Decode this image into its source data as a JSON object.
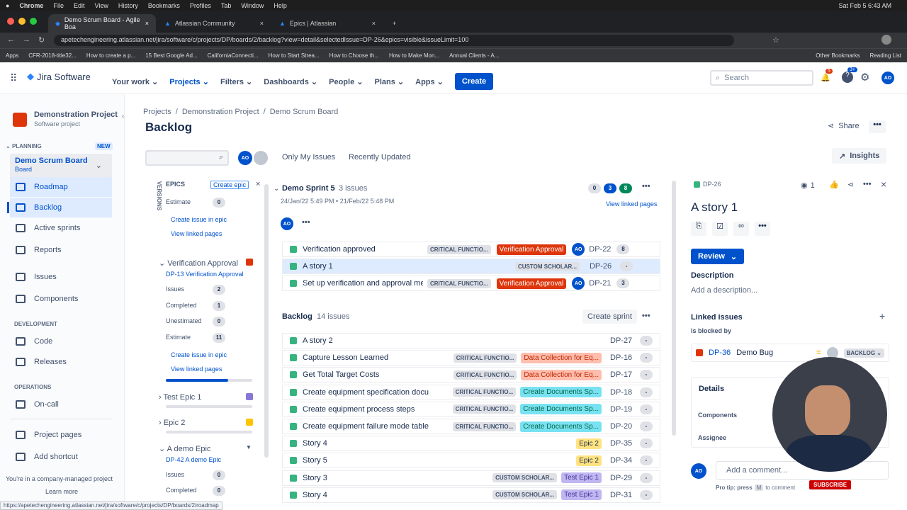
{
  "mac": {
    "apple": "",
    "app": "Chrome",
    "menus": [
      "File",
      "Edit",
      "View",
      "History",
      "Bookmarks",
      "Profiles",
      "Tab",
      "Window",
      "Help"
    ],
    "clock": "Sat Feb 5  6:43 AM"
  },
  "tabs": [
    {
      "label": "Demo Scrum Board - Agile Boa"
    },
    {
      "label": "Atlassian Community"
    },
    {
      "label": "Epics | Atlassian"
    }
  ],
  "url": "apetechengineering.atlassian.net/jira/software/c/projects/DP/boards/2/backlog?view=detail&selectedIssue=DP-26&epics=visible&issueLimit=100",
  "bookmarks": [
    "Apps",
    "CFR-2018-title32...",
    "How to create a p...",
    "15 Best Google Ad...",
    "CaliforniaConnecti...",
    "How to Start Strea...",
    "How to Choose th...",
    "How to Make Mon...",
    "Annual Clients - A..."
  ],
  "bookmarks_right": [
    "Other Bookmarks",
    "Reading List"
  ],
  "nav": {
    "logo": "Jira Software",
    "items": [
      "Your work",
      "Projects",
      "Filters",
      "Dashboards",
      "People",
      "Plans",
      "Apps"
    ],
    "create": "Create",
    "search": "Search",
    "notif_count": "5",
    "help_count": "3+",
    "avatar": "AO"
  },
  "project": {
    "name": "Demonstration Project",
    "type": "Software project"
  },
  "sidebar": {
    "planning": "PLANNING",
    "new": "NEW",
    "board": "Demo Scrum Board",
    "board_sub": "Board",
    "items": [
      "Roadmap",
      "Backlog",
      "Active sprints",
      "Reports",
      "Issues",
      "Components"
    ],
    "development": "DEVELOPMENT",
    "dev_items": [
      "Code",
      "Releases"
    ],
    "operations": "OPERATIONS",
    "ops_items": [
      "On-call"
    ],
    "bottom": [
      "Project pages",
      "Add shortcut"
    ],
    "footer": "You're in a company-managed project",
    "learn": "Learn more"
  },
  "breadcrumb": [
    "Projects",
    "Demonstration Project",
    "Demo Scrum Board"
  ],
  "page_title": "Backlog",
  "share": "Share",
  "insights": "Insights",
  "filters": {
    "only_my": "Only My Issues",
    "recent": "Recently Updated",
    "avatar": "AO"
  },
  "versions": "VERSIONS",
  "epics": {
    "title": "EPICS",
    "create": "Create epic",
    "estimate_label": "Estimate",
    "estimate_val": "0",
    "create_issue": "Create issue in epic",
    "view_linked": "View linked pages",
    "verif": {
      "name": "Verification Approval",
      "key": "DP-13 Verification Approval",
      "issues": "2",
      "completed": "1",
      "unestimated": "0",
      "estimate": "11"
    },
    "labels": {
      "issues": "Issues",
      "completed": "Completed",
      "unestimated": "Unestimated",
      "estimate": "Estimate"
    },
    "others": [
      "Test Epic 1",
      "Epic 2"
    ],
    "demo": {
      "name": "A demo Epic",
      "key": "DP-42 A demo Epic",
      "issues": "0",
      "completed": "0"
    }
  },
  "sprint": {
    "name": "Demo Sprint 5",
    "count": "3 issues",
    "dates": "24/Jan/22 5:49 PM  •  21/Feb/22 5:48 PM",
    "todo": "0",
    "inprog": "3",
    "done": "8",
    "view_linked": "View linked pages",
    "avatar": "AO",
    "rows": [
      {
        "title": "Verification approved",
        "comp": "CRITICAL FUNCTIO...",
        "epic": "Verification Approval",
        "epic_cls": "red",
        "avatar": "AO",
        "key": "DP-22",
        "est": "8"
      },
      {
        "title": "A story 1",
        "comp": "CUSTOM SCHOLAR...",
        "epic": "",
        "epic_cls": "",
        "avatar": "",
        "key": "DP-26",
        "est": "-"
      },
      {
        "title": "Set up verification and approval me",
        "comp": "CRITICAL FUNCTIO...",
        "epic": "Verification Approval",
        "epic_cls": "red",
        "avatar": "AO",
        "key": "DP-21",
        "est": "3"
      }
    ]
  },
  "backlog": {
    "name": "Backlog",
    "count": "14 issues",
    "create_sprint": "Create sprint",
    "rows": [
      {
        "title": "A story 2",
        "comp": "",
        "epic": "",
        "epic_cls": "",
        "key": "DP-27",
        "est": "-"
      },
      {
        "title": "Capture Lesson Learned",
        "comp": "CRITICAL FUNCTIO...",
        "epic": "Data Collection for Eq...",
        "epic_cls": "pinkl",
        "key": "DP-16",
        "est": "-"
      },
      {
        "title": "Get Total Target Costs",
        "comp": "CRITICAL FUNCTIO...",
        "epic": "Data Collection for Eq...",
        "epic_cls": "pinkl",
        "key": "DP-17",
        "est": "-"
      },
      {
        "title": "Create equipment specification docu",
        "comp": "CRITICAL FUNCTIO...",
        "epic": "Create Documents Sp...",
        "epic_cls": "teal",
        "key": "DP-18",
        "est": "-"
      },
      {
        "title": "Create equipment process steps",
        "comp": "CRITICAL FUNCTIO...",
        "epic": "Create Documents Sp...",
        "epic_cls": "teal",
        "key": "DP-19",
        "est": "-"
      },
      {
        "title": "Create equipment failure mode table",
        "comp": "CRITICAL FUNCTIO...",
        "epic": "Create Documents Sp...",
        "epic_cls": "teal",
        "key": "DP-20",
        "est": "-"
      },
      {
        "title": "Story 4",
        "comp": "",
        "epic": "Epic 2",
        "epic_cls": "yel",
        "key": "DP-35",
        "est": "-"
      },
      {
        "title": "Story 5",
        "comp": "",
        "epic": "Epic 2",
        "epic_cls": "yel",
        "key": "DP-34",
        "est": "-"
      },
      {
        "title": "Story 3",
        "comp": "CUSTOM SCHOLAR...",
        "epic": "Test Epic 1",
        "epic_cls": "purp",
        "key": "DP-29",
        "est": "-"
      },
      {
        "title": "Story 4",
        "comp": "CUSTOM SCHOLAR...",
        "epic": "Test Epic 1",
        "epic_cls": "purp",
        "key": "DP-31",
        "est": "-"
      }
    ]
  },
  "detail": {
    "key": "DP-26",
    "watch": "1",
    "title": "A story 1",
    "status": "Review",
    "desc_label": "Description",
    "desc_ph": "Add a description...",
    "linked": "Linked issues",
    "blocked_by": "is blocked by",
    "link_key": "DP-36",
    "link_title": "Demo Bug",
    "link_status": "BACKLOG",
    "details": "Details",
    "components": "Components",
    "assignee": "Assignee",
    "comment_ph": "Add a comment...",
    "protip": "Pro tip: press",
    "protip_key": "M",
    "protip_end": "to comment",
    "avatar": "AO",
    "subscribe": "SUBSCRIBE"
  },
  "status_url": "https://apetechengineering.atlassian.net/jira/software/c/projects/DP/boards/2/roadmap"
}
